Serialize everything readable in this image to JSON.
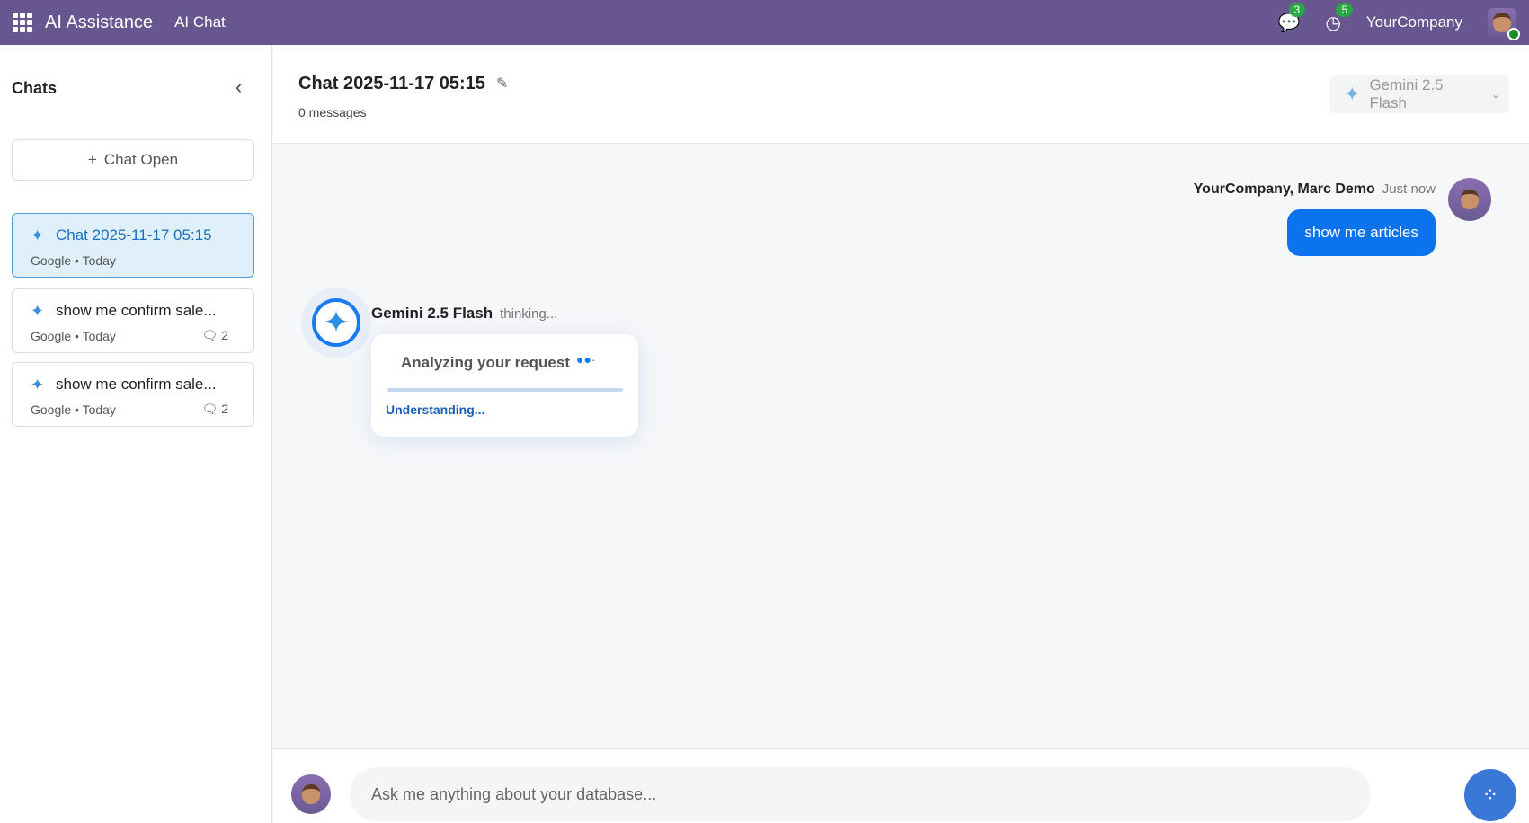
{
  "topbar": {
    "brand": "AI Assistance",
    "menu": "AI Chat",
    "messages_badge": "3",
    "activities_badge": "5",
    "company": "YourCompany"
  },
  "sidebar": {
    "title": "Chats",
    "new_chat": "Chat Open",
    "items": [
      {
        "title": "Chat 2025-11-17 05:15",
        "sub": "Google • Today",
        "count": ""
      },
      {
        "title": "show me confirm sale...",
        "sub": "Google • Today",
        "count": "2"
      },
      {
        "title": "show me confirm sale...",
        "sub": "Google • Today",
        "count": "2"
      }
    ]
  },
  "header": {
    "title": "Chat 2025-11-17 05:15",
    "subtitle": "0 messages",
    "model": "Gemini 2.5 Flash"
  },
  "messages": {
    "user_name": "YourCompany, Marc Demo",
    "user_time": "Just now",
    "user_text": "show me articles",
    "ai_name": "Gemini 2.5 Flash",
    "ai_status": "thinking...",
    "progress_title": "Analyzing your request",
    "progress_step": "Understanding..."
  },
  "composer": {
    "placeholder": "Ask me anything about your database..."
  }
}
